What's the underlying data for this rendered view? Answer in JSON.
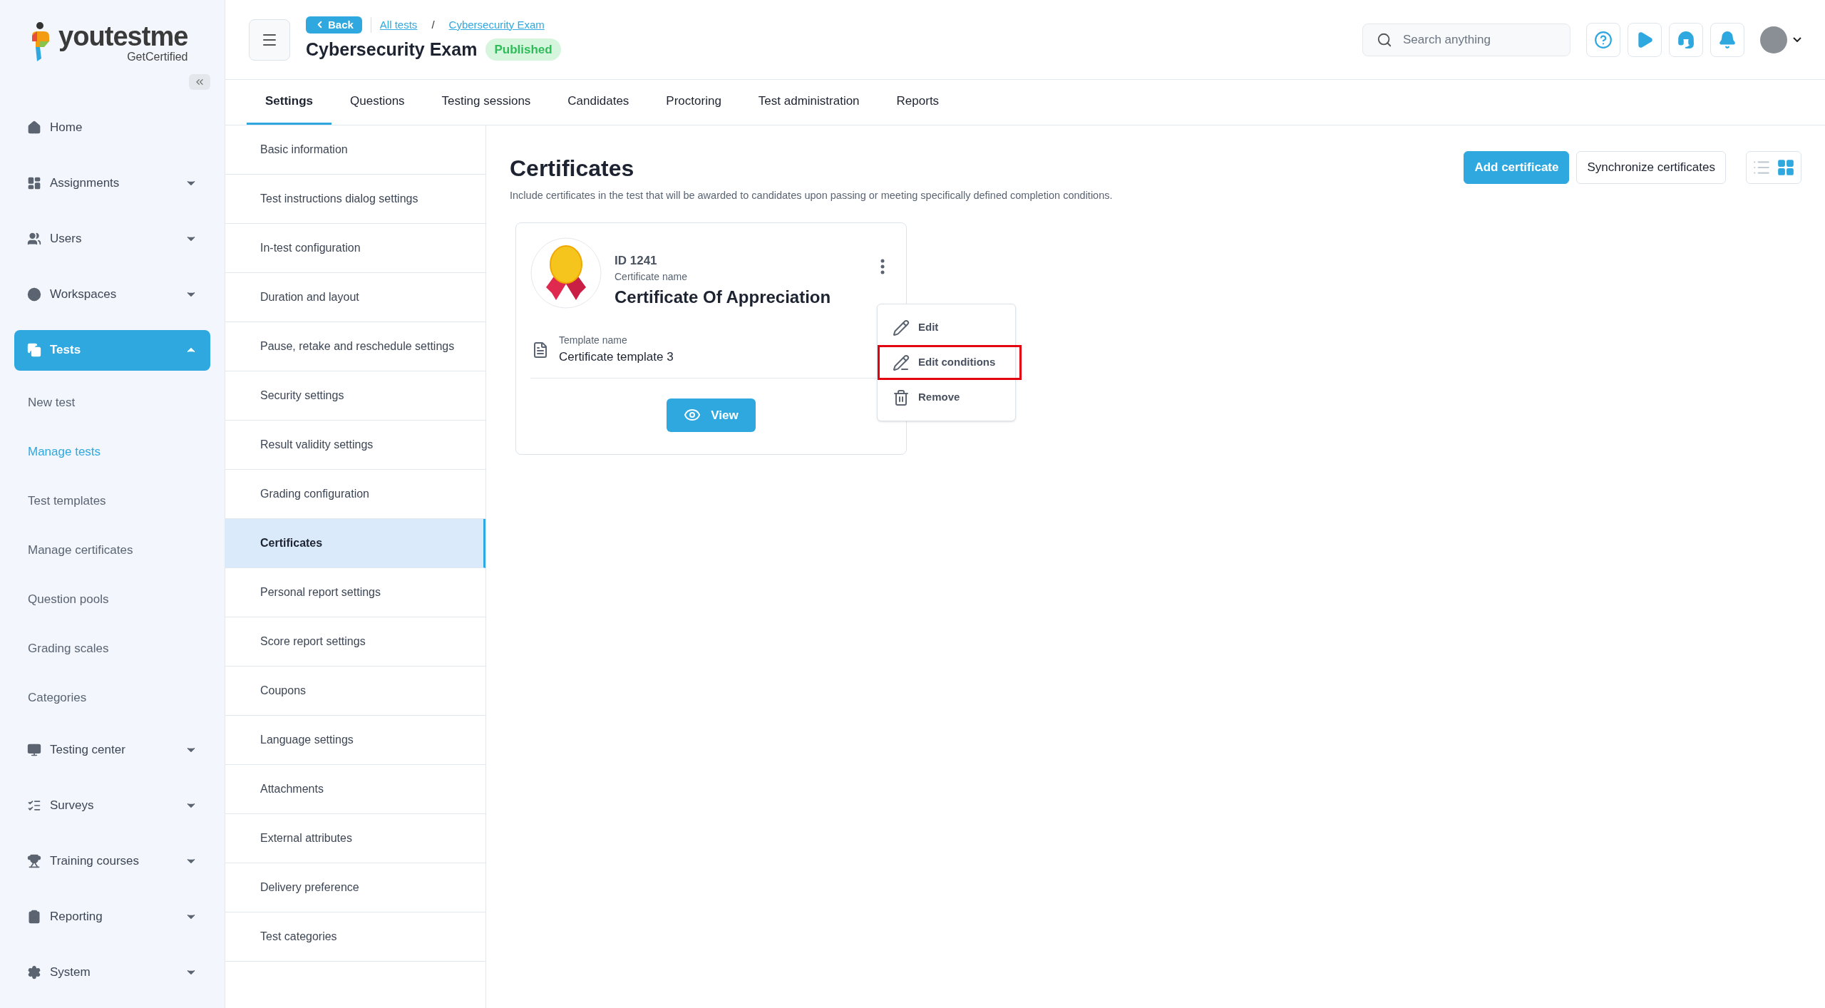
{
  "logo": {
    "name": "youtestme",
    "tagline": "GetCertified"
  },
  "sidebar": {
    "items": [
      {
        "label": "Home",
        "kind": "link",
        "selected": false
      },
      {
        "label": "Assignments",
        "kind": "group",
        "selected": false,
        "expanded": false
      },
      {
        "label": "Users",
        "kind": "group",
        "selected": false,
        "expanded": false
      },
      {
        "label": "Workspaces",
        "kind": "group",
        "selected": false,
        "expanded": false
      },
      {
        "label": "Tests",
        "kind": "group",
        "selected": true,
        "expanded": true,
        "children": [
          {
            "label": "New test",
            "selected": false
          },
          {
            "label": "Manage tests",
            "selected": true
          },
          {
            "label": "Test templates",
            "selected": false
          },
          {
            "label": "Manage certificates",
            "selected": false
          },
          {
            "label": "Question pools",
            "selected": false
          },
          {
            "label": "Grading scales",
            "selected": false
          },
          {
            "label": "Categories",
            "selected": false
          }
        ]
      },
      {
        "label": "Testing center",
        "kind": "group",
        "selected": false,
        "expanded": false
      },
      {
        "label": "Surveys",
        "kind": "group",
        "selected": false,
        "expanded": false
      },
      {
        "label": "Training courses",
        "kind": "group",
        "selected": false,
        "expanded": false
      },
      {
        "label": "Reporting",
        "kind": "group",
        "selected": false,
        "expanded": false
      },
      {
        "label": "System",
        "kind": "group",
        "selected": false,
        "expanded": false
      }
    ]
  },
  "header": {
    "back": "Back",
    "breadcrumbs": [
      "All tests",
      "Cybersecurity Exam"
    ],
    "separator": "/",
    "title": "Cybersecurity Exam",
    "status": "Published",
    "search": {
      "placeholder": "Search anything"
    }
  },
  "tabs": [
    {
      "label": "Settings",
      "selected": true
    },
    {
      "label": "Questions",
      "selected": false
    },
    {
      "label": "Testing sessions",
      "selected": false
    },
    {
      "label": "Candidates",
      "selected": false
    },
    {
      "label": "Proctoring",
      "selected": false
    },
    {
      "label": "Test administration",
      "selected": false
    },
    {
      "label": "Reports",
      "selected": false
    }
  ],
  "settings_menu": [
    {
      "label": "Basic information",
      "selected": false
    },
    {
      "label": "Test instructions dialog settings",
      "selected": false
    },
    {
      "label": "In-test configuration",
      "selected": false
    },
    {
      "label": "Duration and layout",
      "selected": false
    },
    {
      "label": "Pause, retake and reschedule settings",
      "selected": false
    },
    {
      "label": "Security settings",
      "selected": false
    },
    {
      "label": "Result validity settings",
      "selected": false
    },
    {
      "label": "Grading configuration",
      "selected": false
    },
    {
      "label": "Certificates",
      "selected": true
    },
    {
      "label": "Personal report settings",
      "selected": false
    },
    {
      "label": "Score report settings",
      "selected": false
    },
    {
      "label": "Coupons",
      "selected": false
    },
    {
      "label": "Language settings",
      "selected": false
    },
    {
      "label": "Attachments",
      "selected": false
    },
    {
      "label": "External attributes",
      "selected": false
    },
    {
      "label": "Delivery preference",
      "selected": false
    },
    {
      "label": "Test categories",
      "selected": false
    }
  ],
  "content": {
    "title": "Certificates",
    "description": "Include certificates in the test that will be awarded to candidates upon passing or meeting specifically defined completion conditions.",
    "buttons": [
      "Add certificate",
      "Synchronize certificates"
    ],
    "view_toggle": [
      {
        "kind": "list",
        "selected": false
      },
      {
        "kind": "grid",
        "selected": true
      }
    ],
    "certificate": {
      "id": "ID 1241",
      "name_label": "Certificate name",
      "name": "Certificate Of Appreciation",
      "template_label": "Template name",
      "template": "Certificate template 3",
      "view": "View"
    },
    "menu": [
      {
        "kind": "edit",
        "label": "Edit",
        "highlighted": false
      },
      {
        "kind": "conditions",
        "label": "Edit conditions",
        "highlighted": true
      },
      {
        "kind": "remove",
        "label": "Remove",
        "highlighted": false
      }
    ]
  }
}
